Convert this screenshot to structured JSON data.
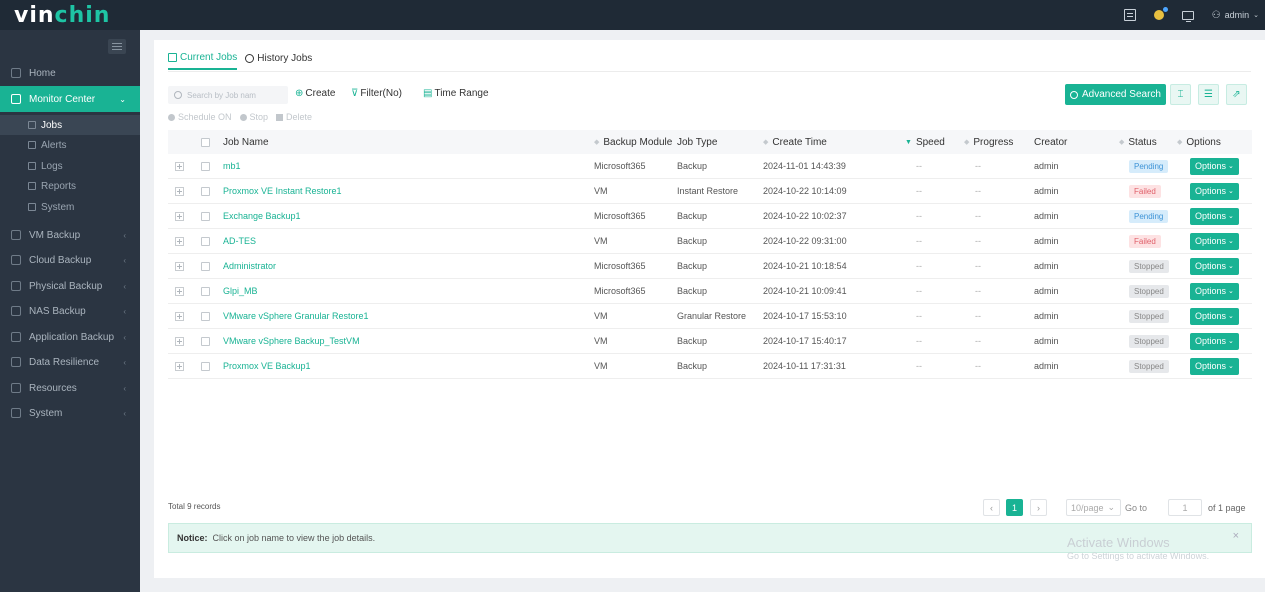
{
  "brand": {
    "logo_prefix": "vin",
    "logo_suffix": "chin",
    "accent": "#19b394"
  },
  "topbar": {
    "user": "admin"
  },
  "sidebar": {
    "home": "Home",
    "monitor_center": "Monitor Center",
    "sub_items": [
      "Jobs",
      "Alerts",
      "Logs",
      "Reports",
      "System"
    ],
    "items": [
      "VM Backup",
      "Cloud Backup",
      "Physical Backup",
      "NAS Backup",
      "Application Backup",
      "Data Resilience",
      "Resources",
      "System"
    ]
  },
  "tabs": {
    "current": "Current Jobs",
    "history": "History Jobs"
  },
  "toolbar": {
    "search_placeholder": "Search by Job nam",
    "create": "Create",
    "filter": "Filter(No)",
    "time_range": "Time Range",
    "advanced_search": "Advanced Search",
    "schedule_on": "Schedule ON",
    "stop": "Stop",
    "delete": "Delete"
  },
  "table": {
    "headers": {
      "job_name": "Job Name",
      "backup_module": "Backup Module",
      "job_type": "Job Type",
      "create_time": "Create Time",
      "speed": "Speed",
      "progress": "Progress",
      "creator": "Creator",
      "status": "Status",
      "options": "Options"
    },
    "rows": [
      {
        "name": "mb1",
        "module": "Microsoft365",
        "type": "Backup",
        "time": "2024-11-01 14:43:39",
        "speed": "--",
        "progress": "--",
        "creator": "admin",
        "status": "Pending",
        "options": "Options"
      },
      {
        "name": "Proxmox VE Instant Restore1",
        "module": "VM",
        "type": "Instant Restore",
        "time": "2024-10-22 10:14:09",
        "speed": "--",
        "progress": "--",
        "creator": "admin",
        "status": "Failed",
        "options": "Options"
      },
      {
        "name": "Exchange Backup1",
        "module": "Microsoft365",
        "type": "Backup",
        "time": "2024-10-22 10:02:37",
        "speed": "--",
        "progress": "--",
        "creator": "admin",
        "status": "Pending",
        "options": "Options"
      },
      {
        "name": "AD-TES",
        "module": "VM",
        "type": "Backup",
        "time": "2024-10-22 09:31:00",
        "speed": "--",
        "progress": "--",
        "creator": "admin",
        "status": "Failed",
        "options": "Options"
      },
      {
        "name": "Administrator",
        "module": "Microsoft365",
        "type": "Backup",
        "time": "2024-10-21 10:18:54",
        "speed": "--",
        "progress": "--",
        "creator": "admin",
        "status": "Stopped",
        "options": "Options"
      },
      {
        "name": "Glpi_MB",
        "module": "Microsoft365",
        "type": "Backup",
        "time": "2024-10-21 10:09:41",
        "speed": "--",
        "progress": "--",
        "creator": "admin",
        "status": "Stopped",
        "options": "Options"
      },
      {
        "name": "VMware vSphere Granular Restore1",
        "module": "VM",
        "type": "Granular Restore",
        "time": "2024-10-17 15:53:10",
        "speed": "--",
        "progress": "--",
        "creator": "admin",
        "status": "Stopped",
        "options": "Options"
      },
      {
        "name": "VMware vSphere Backup_TestVM",
        "module": "VM",
        "type": "Backup",
        "time": "2024-10-17 15:40:17",
        "speed": "--",
        "progress": "--",
        "creator": "admin",
        "status": "Stopped",
        "options": "Options"
      },
      {
        "name": "Proxmox VE Backup1",
        "module": "VM",
        "type": "Backup",
        "time": "2024-10-11 17:31:31",
        "speed": "--",
        "progress": "--",
        "creator": "admin",
        "status": "Stopped",
        "options": "Options"
      }
    ]
  },
  "pagination": {
    "total": "Total 9 records",
    "prev": "‹",
    "current": "1",
    "next": "›",
    "page_size": "10/page",
    "goto": "Go to",
    "goto_value": "1",
    "of_pages": "of 1 page"
  },
  "notice": {
    "label": "Notice:",
    "text": "Click on job name to view the job details."
  },
  "watermark": {
    "title": "Activate Windows",
    "subtitle": "Go to Settings to activate Windows."
  }
}
